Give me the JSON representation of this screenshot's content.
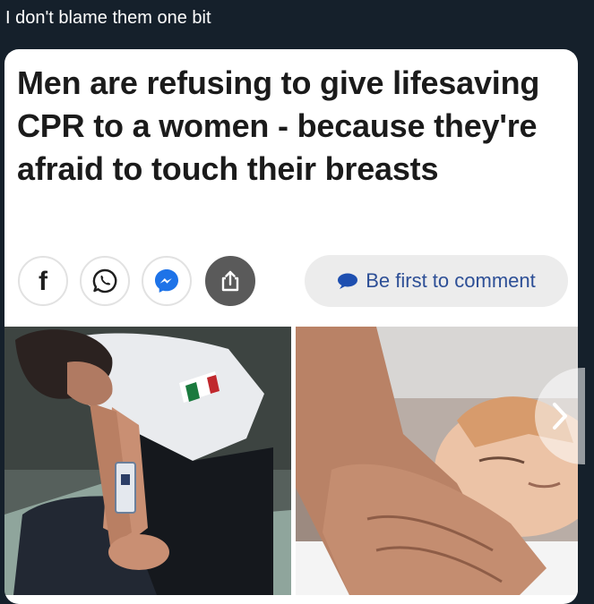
{
  "post": {
    "caption": "I don't blame them one bit"
  },
  "article": {
    "headline": "Men are refusing to give lifesaving CPR to a women - because they're afraid to touch their breasts",
    "share_buttons": [
      {
        "icon": "facebook-icon",
        "glyph": "f"
      },
      {
        "icon": "whatsapp-icon"
      },
      {
        "icon": "messenger-icon"
      },
      {
        "icon": "share-icon"
      }
    ],
    "comment_label": "Be first to comment"
  },
  "colors": {
    "page_background": "#15202b",
    "card_background": "#ffffff",
    "comment_text": "#2d4f96",
    "messenger_blue": "#1e73e8",
    "share_button_bg": "#5a5a5a"
  }
}
